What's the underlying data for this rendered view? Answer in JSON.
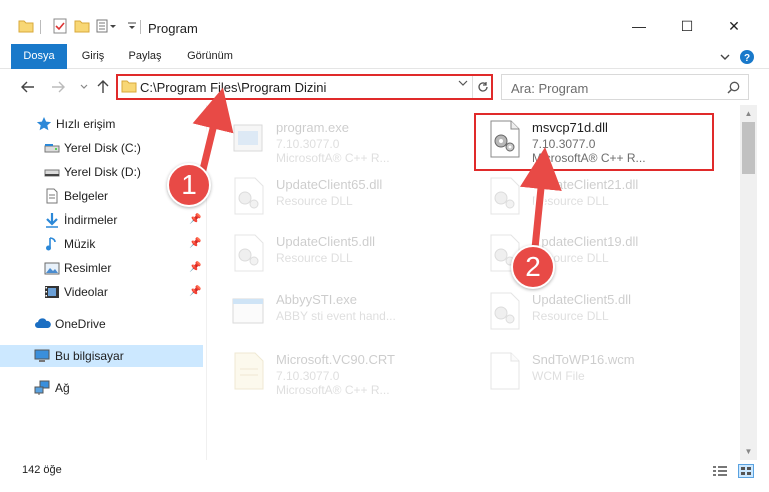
{
  "window": {
    "title": "Program",
    "controls": {
      "minimize": "—",
      "maximize": "☐",
      "close": "✕"
    }
  },
  "ribbon": {
    "tabs": [
      "Dosya",
      "Giriş",
      "Paylaş",
      "Görünüm"
    ],
    "active_tab": "Dosya"
  },
  "address": {
    "path": "C:\\Program Files\\Program Dizini",
    "search_placeholder": "Ara: Program"
  },
  "sidebar": {
    "items": [
      {
        "label": "Hızlı erişim",
        "icon": "star-icon",
        "pinned": false
      },
      {
        "label": "Yerel Disk (C:)",
        "icon": "drive-icon",
        "pinned": false
      },
      {
        "label": "Yerel Disk (D:)",
        "icon": "drive-icon",
        "pinned": false
      },
      {
        "label": "Belgeler",
        "icon": "document-icon",
        "pinned": false
      },
      {
        "label": "İndirmeler",
        "icon": "download-icon",
        "pinned": true
      },
      {
        "label": "Müzik",
        "icon": "music-icon",
        "pinned": true
      },
      {
        "label": "Resimler",
        "icon": "pictures-icon",
        "pinned": true
      },
      {
        "label": "Videolar",
        "icon": "video-icon",
        "pinned": true
      },
      {
        "label": "OneDrive",
        "icon": "cloud-icon",
        "pinned": false
      },
      {
        "label": "Bu bilgisayar",
        "icon": "computer-icon",
        "pinned": false,
        "selected": true
      },
      {
        "label": "Ağ",
        "icon": "network-icon",
        "pinned": false
      }
    ]
  },
  "files": [
    {
      "name": "program.exe",
      "line1": "7.10.3077.0",
      "line2": "MicrosoftA® C++ R...",
      "icon": "exe-icon",
      "faded": true
    },
    {
      "name": "msvcp71d.dll",
      "line1": "7.10.3077.0",
      "line2": "MicrosoftA® C++ R...",
      "icon": "dll-icon",
      "faded": false,
      "highlighted": true
    },
    {
      "name": "UpdateClient65.dll",
      "line1": "Resource DLL",
      "line2": "",
      "icon": "dll-icon",
      "faded": true
    },
    {
      "name": "UpdateClient21.dll",
      "line1": "Resource DLL",
      "line2": "",
      "icon": "dll-icon",
      "faded": true
    },
    {
      "name": "UpdateClient5.dll",
      "line1": "Resource DLL",
      "line2": "",
      "icon": "dll-icon",
      "faded": true
    },
    {
      "name": "UpdateClient19.dll",
      "line1": "Resource DLL",
      "line2": "",
      "icon": "dll-icon",
      "faded": true
    },
    {
      "name": "AbbyySTI.exe",
      "line1": "ABBY sti event hand...",
      "line2": "",
      "icon": "exe-icon",
      "faded": true
    },
    {
      "name": "UpdateClient5.dll",
      "line1": "Resource DLL",
      "line2": "",
      "icon": "dll-icon",
      "faded": true
    },
    {
      "name": "Microsoft.VC90.CRT",
      "line1": "7.10.3077.0",
      "line2": "MicrosoftA® C++ R...",
      "icon": "manifest-icon",
      "faded": true
    },
    {
      "name": "SndToWP16.wcm",
      "line1": "WCM File",
      "line2": "",
      "icon": "blank-file-icon",
      "faded": true
    }
  ],
  "status": {
    "item_count": "142 öğe"
  },
  "annotations": {
    "badge1": "1",
    "badge2": "2",
    "color": "#e84a46"
  },
  "colors": {
    "accent": "#1979ca",
    "selection": "#cce8ff",
    "highlight_border": "#e02a2a"
  }
}
